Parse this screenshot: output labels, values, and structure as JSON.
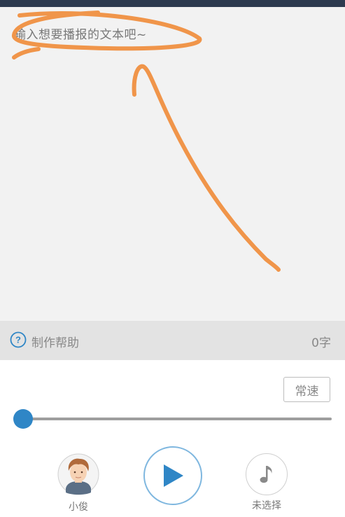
{
  "editor": {
    "placeholder": "输入想要播报的文本吧~"
  },
  "help_bar": {
    "help_label": "制作帮助",
    "help_icon": "question-circle-icon",
    "char_count": "0字"
  },
  "controls": {
    "speed_label": "常速",
    "speed_slider_value": 0,
    "voice_label": "小俊",
    "music_label": "未选择",
    "play_icon": "play-icon",
    "music_icon": "music-note-icon"
  },
  "colors": {
    "accent": "#2f86c6",
    "annotation": "#f0954a",
    "topbar": "#2d3a4f"
  }
}
